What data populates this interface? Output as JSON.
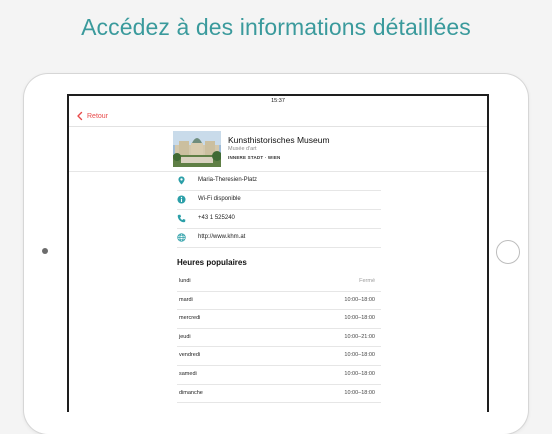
{
  "headline": "Accédez à des informations détaillées",
  "status_bar": {
    "time": "15:37"
  },
  "navbar": {
    "back_label": "Retour"
  },
  "place": {
    "name": "Kunsthistorisches Museum",
    "category": "Musée d'art",
    "district": "INNERE STADT · WIEN"
  },
  "info": [
    {
      "icon": "map-pin-icon",
      "text": "Maria-Theresien-Platz"
    },
    {
      "icon": "info-icon",
      "text": "Wi-Fi disponible"
    },
    {
      "icon": "phone-icon",
      "text": "+43 1 525240"
    },
    {
      "icon": "globe-icon",
      "text": "http://www.khm.at"
    }
  ],
  "hours": {
    "title": "Heures populaires",
    "rows": [
      {
        "day": "lundi",
        "time": "Fermé"
      },
      {
        "day": "mardi",
        "time": "10:00–18:00"
      },
      {
        "day": "mercredi",
        "time": "10:00–18:00"
      },
      {
        "day": "jeudi",
        "time": "10:00–21:00"
      },
      {
        "day": "vendredi",
        "time": "10:00–18:00"
      },
      {
        "day": "samedi",
        "time": "10:00–18:00"
      },
      {
        "day": "dimanche",
        "time": "10:00–18:00"
      }
    ]
  },
  "colors": {
    "headline": "#3a9a9c",
    "accent": "#e84a4a",
    "icon": "#2b9fa8"
  }
}
